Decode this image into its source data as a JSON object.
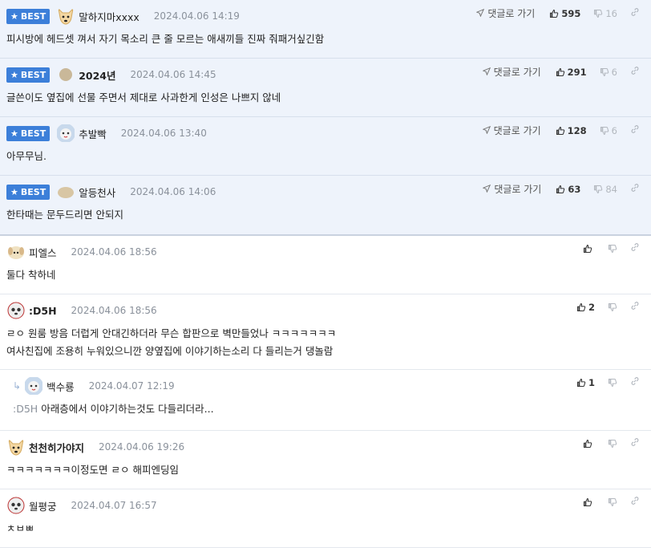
{
  "goto_label": "댓글로 가기",
  "best_label": "BEST",
  "best_comments": [
    {
      "nick": "말하지마xxxx",
      "date": "2024.04.06 14:19",
      "text": "피시방에 헤드셋 껴서 자기 목소리 큰 줄 모르는 애새끼들 진짜 줘패거싶긴함",
      "up": "595",
      "down": "16",
      "avatar": "dog-face-icon",
      "bold": false
    },
    {
      "nick": "2024년",
      "date": "2024.04.06 14:45",
      "text": "글쓴이도 옆집에 선물 주면서 제대로 사과한게 인성은 나쁘지 않네",
      "up": "291",
      "down": "6",
      "avatar": "circle-avatar-icon",
      "bold": true
    },
    {
      "nick": "추발빡",
      "date": "2024.04.06 13:40",
      "text": "아무무님.",
      "up": "128",
      "down": "6",
      "avatar": "animal-avatar-icon",
      "bold": false
    },
    {
      "nick": "알등천사",
      "date": "2024.04.06 14:06",
      "text": "한타때는 문두드리면 안되지",
      "up": "63",
      "down": "84",
      "avatar": "blob-avatar-icon",
      "bold": false
    }
  ],
  "comments": [
    {
      "nick": "피엘스",
      "date": "2024.04.06 18:56",
      "lines": [
        "둘다 착하네"
      ],
      "up": "",
      "avatar": "puppy-avatar-icon",
      "bold": false
    },
    {
      "nick": ":D5H",
      "date": "2024.04.06 18:56",
      "lines": [
        "ㄹㅇ 원룸 방음 더럽게 안대긴하더라 무슨 합판으로 벽만들었나 ㅋㅋㅋㅋㅋㅋㅋ",
        "여사친집에 조용히 누워있으니깐 양옆집에 이야기하는소리 다 들리는거 댕놀람"
      ],
      "up": "2",
      "avatar": "panda-avatar-icon",
      "bold": true
    },
    {
      "nick": "백수룡",
      "date": "2024.04.07 12:19",
      "mention": ":D5H",
      "lines": [
        "아래층에서 이야기하는것도 다들리더라..."
      ],
      "up": "1",
      "avatar": "animal-avatar-icon",
      "bold": false,
      "reply": true
    },
    {
      "nick": "천천히가야지",
      "date": "2024.04.06 19:26",
      "lines": [
        "ㅋㅋㅋㅋㅋㅋㅋ이정도면 ㄹㅇ 해피엔딩임"
      ],
      "up": "",
      "avatar": "dog-face-icon",
      "bold": true
    },
    {
      "nick": "월평궁",
      "date": "2024.04.07 16:57",
      "lines": [
        "ㅊㅂㅃ"
      ],
      "up": "",
      "avatar": "panda-avatar-icon",
      "bold": false
    }
  ],
  "colors": {
    "best_bg": "#eef3fb",
    "badge": "#3c7fd9"
  }
}
